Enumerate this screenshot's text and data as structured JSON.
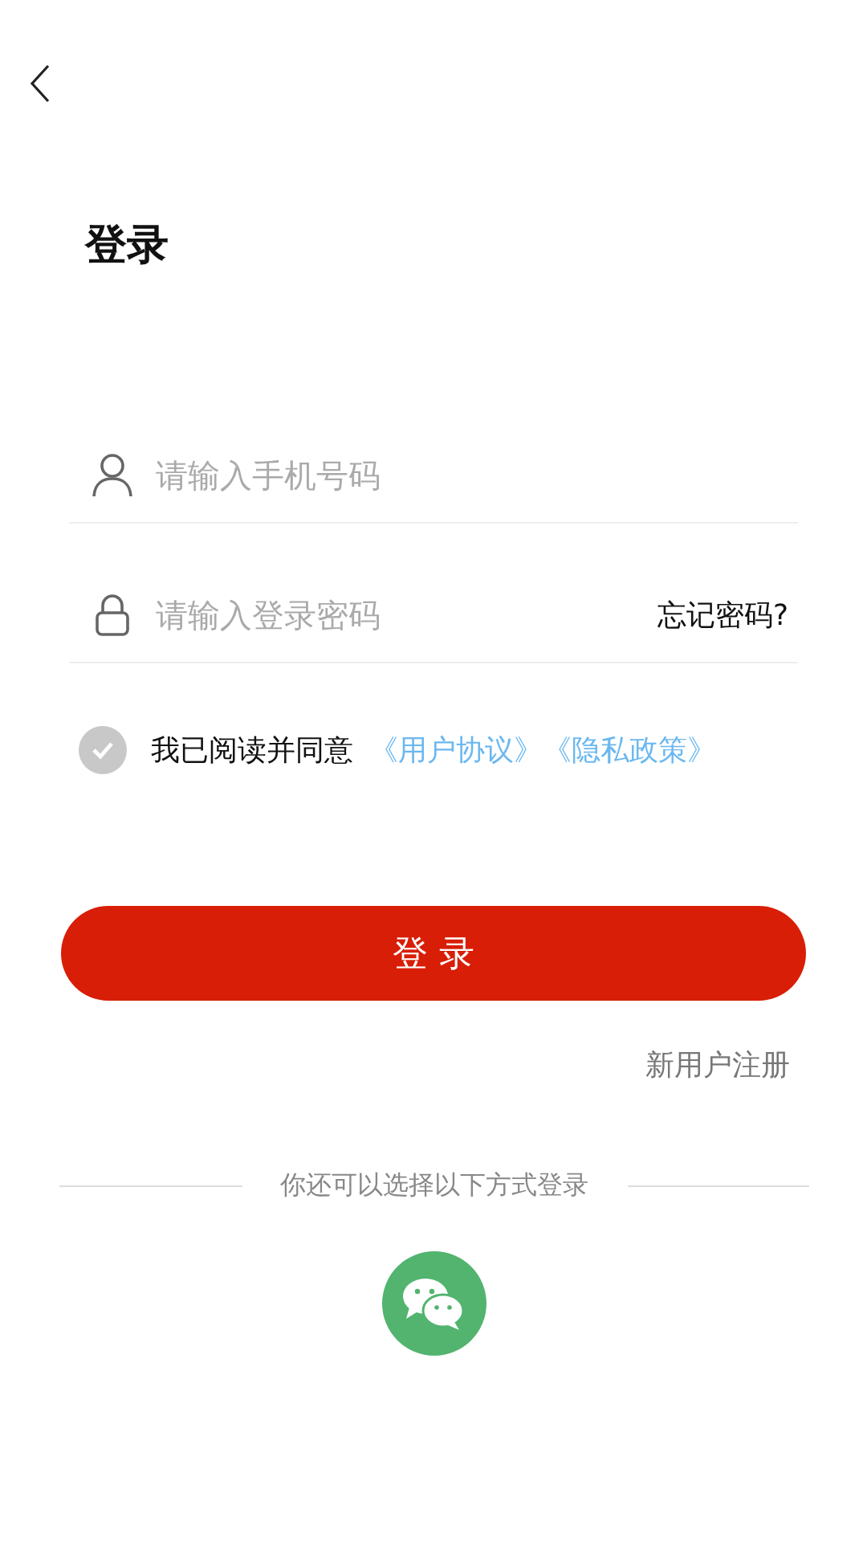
{
  "title": "登录",
  "fields": [
    {
      "kind": "phone",
      "placeholder": "请输入手机号码"
    },
    {
      "kind": "password",
      "placeholder": "请输入登录密码",
      "link": "忘记密码?"
    }
  ],
  "agreement": {
    "checked": false,
    "text": "我已阅读并同意",
    "links": [
      "《用户协议》",
      "《隐私政策》"
    ]
  },
  "login_button": "登 录",
  "register_link": "新用户注册",
  "alt_login": {
    "label": "你还可以选择以下方式登录"
  }
}
